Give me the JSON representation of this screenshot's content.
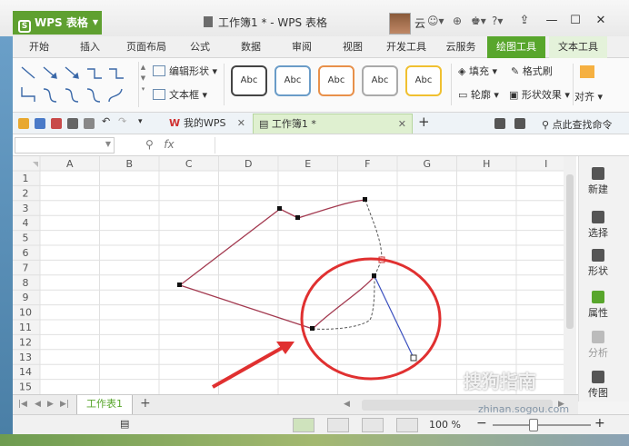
{
  "app": {
    "logo": "WPS 表格",
    "doc_title": "工作簿1 * - WPS 表格",
    "user_name": "云",
    "help": "?"
  },
  "ribbon_tabs": [
    "开始",
    "插入",
    "页面布局",
    "公式",
    "数据",
    "审阅",
    "视图",
    "开发工具",
    "云服务",
    "绘图工具",
    "文本工具"
  ],
  "active_tab": "绘图工具",
  "ribbon": {
    "edit_shape": "编辑形状",
    "text_box": "文本框",
    "style_label": "Abc",
    "fill": "填充",
    "format_brush": "格式刷",
    "outline": "轮廓",
    "shape_effect": "形状效果",
    "align": "对齐"
  },
  "doc_tabs": {
    "my_wps": "我的WPS",
    "workbook": "工作簿1 *",
    "search_cmd": "点此查找命令"
  },
  "formula_bar": {
    "fx": "fx",
    "cell_ref": "",
    "content": ""
  },
  "columns": [
    "A",
    "B",
    "C",
    "D",
    "E",
    "F",
    "G",
    "H",
    "I"
  ],
  "rows": [
    "1",
    "2",
    "3",
    "4",
    "5",
    "6",
    "7",
    "8",
    "9",
    "10",
    "11",
    "12",
    "13",
    "14",
    "15"
  ],
  "side_panel": [
    "新建",
    "选择",
    "形状",
    "属性",
    "分析",
    "传图"
  ],
  "sheet": {
    "name": "Sheet1",
    "label": "工作表1"
  },
  "status": {
    "zoom": "100 %"
  },
  "watermark": {
    "text": "搜狗指南",
    "url": "zhinan.sogou.com"
  },
  "colors": {
    "accent": "#58a62c",
    "shape_line": "#a33a50",
    "handle_line": "#3a4fbf",
    "annotation": "#e03030"
  }
}
